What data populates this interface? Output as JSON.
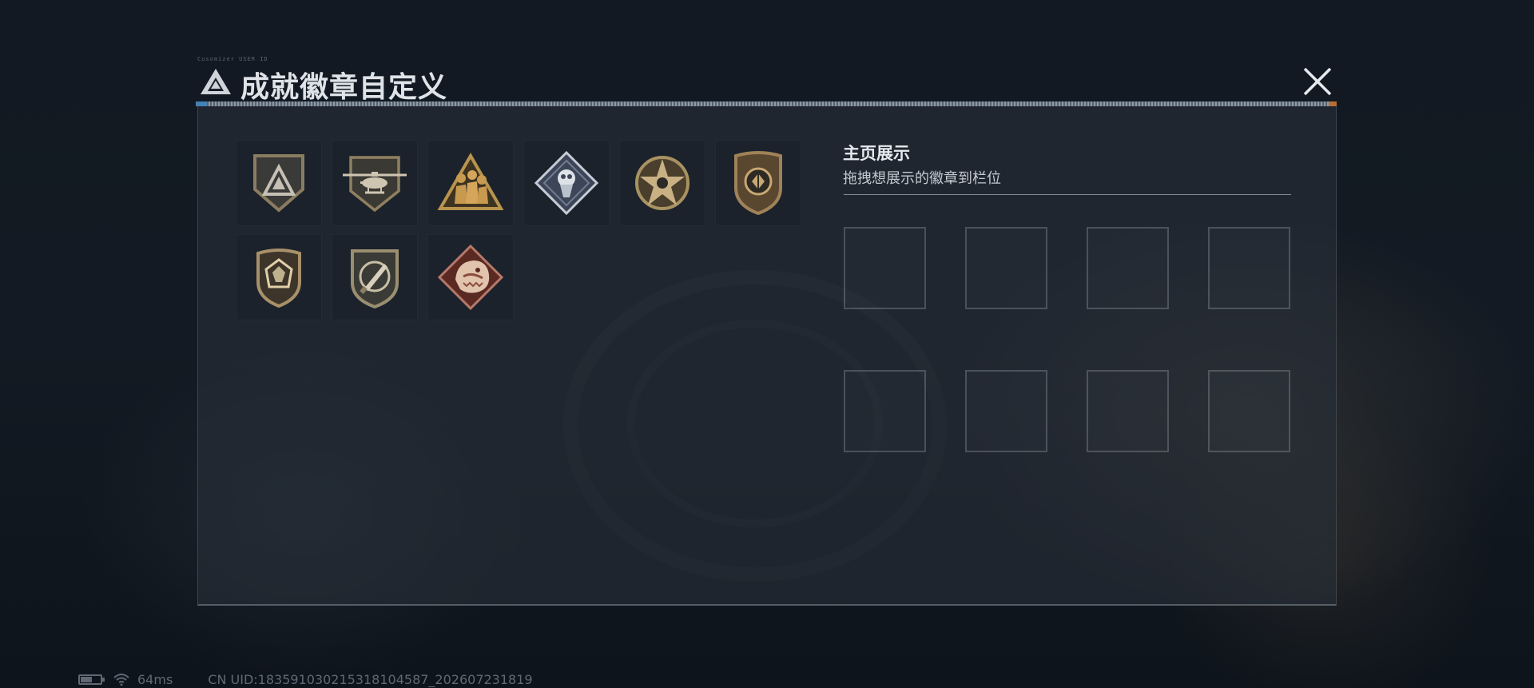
{
  "window": {
    "title": "成就徽章自定义",
    "micro_text": "Cusomizer USER ID"
  },
  "badges": [
    {
      "name": "Delta triangle badge",
      "icon": "delta-shield-icon",
      "color": "#8a7c60"
    },
    {
      "name": "Helicopter badge",
      "icon": "helicopter-shield-icon",
      "color": "#8f8060"
    },
    {
      "name": "Squad triangle badge",
      "icon": "squad-triangle-icon",
      "color": "#b8944e"
    },
    {
      "name": "Silver diamond badge",
      "icon": "silver-diamond-icon",
      "color": "#b9c1cc"
    },
    {
      "name": "Star crest badge",
      "icon": "star-crest-icon",
      "color": "#a89262"
    },
    {
      "name": "Tactical shield badge",
      "icon": "tactical-shield-icon",
      "color": "#a08258"
    },
    {
      "name": "Gem shield badge",
      "icon": "gem-shield-icon",
      "color": "#a8906a"
    },
    {
      "name": "Knife shield badge",
      "icon": "knife-shield-icon",
      "color": "#9a8e70"
    },
    {
      "name": "Beast diamond badge",
      "icon": "beast-diamond-icon",
      "color": "#d0a88a"
    }
  ],
  "showcase": {
    "title": "主页展示",
    "subtitle": "拖拽想展示的徽章到栏位",
    "slot_count": 8
  },
  "status": {
    "ping": "64ms",
    "uid": "CN UID:183591030215318104587_202607231819"
  },
  "colors": {
    "accent_blue": "#4a8ec4",
    "accent_orange": "#c87a3a",
    "badge_gold": "#b8944e"
  }
}
